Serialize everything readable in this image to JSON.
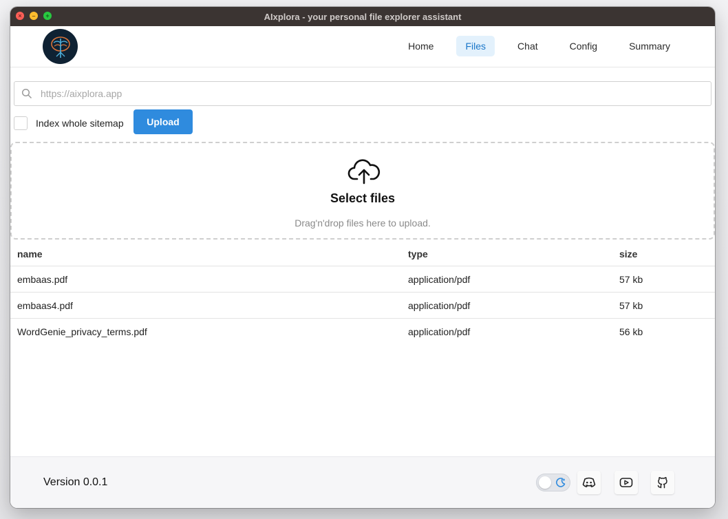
{
  "window": {
    "title": "AIxplora - your personal file explorer assistant"
  },
  "nav": {
    "items": [
      {
        "label": "Home",
        "active": false
      },
      {
        "label": "Files",
        "active": true
      },
      {
        "label": "Chat",
        "active": false
      },
      {
        "label": "Config",
        "active": false
      },
      {
        "label": "Summary",
        "active": false
      }
    ]
  },
  "search": {
    "placeholder": "https://aixplora.app",
    "value": ""
  },
  "options": {
    "index_sitemap_label": "Index whole sitemap",
    "index_sitemap_checked": false,
    "upload_label": "Upload"
  },
  "dropzone": {
    "title": "Select files",
    "subtitle": "Drag'n'drop files here to upload."
  },
  "table": {
    "columns": [
      "name",
      "type",
      "size"
    ],
    "rows": [
      {
        "name": "embaas.pdf",
        "type": "application/pdf",
        "size": "57 kb"
      },
      {
        "name": "embaas4.pdf",
        "type": "application/pdf",
        "size": "57 kb"
      },
      {
        "name": "WordGenie_privacy_terms.pdf",
        "type": "application/pdf",
        "size": "56 kb"
      }
    ]
  },
  "footer": {
    "version": "Version 0.0.1",
    "dark_mode": false,
    "icons": [
      "moon-icon",
      "discord-icon",
      "youtube-icon",
      "github-icon"
    ]
  },
  "colors": {
    "accent": "#2f8bde",
    "nav_active_bg": "#e3f1fc",
    "titlebar": "#3b3432"
  }
}
